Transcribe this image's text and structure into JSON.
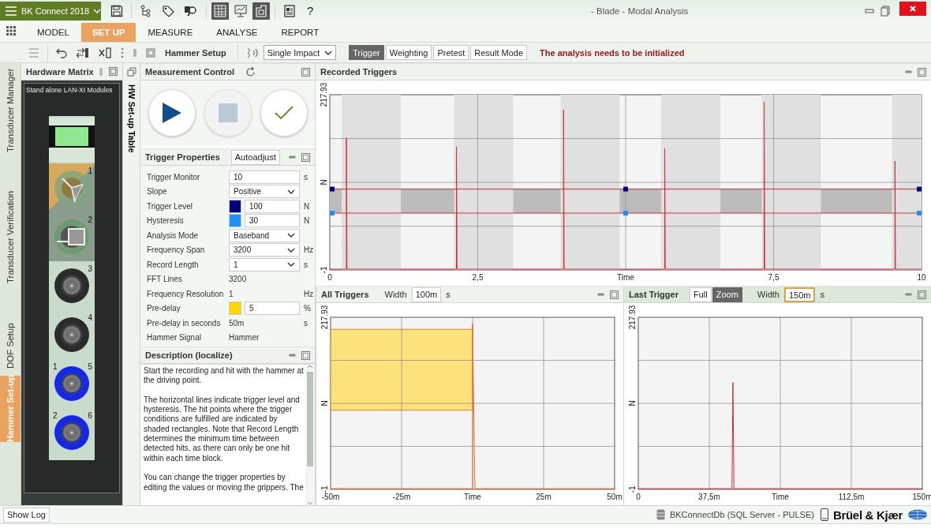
{
  "app_menu": {
    "label": "BK Connect 2018"
  },
  "window": {
    "title": "- Blade - Modal Analysis",
    "help": "?"
  },
  "view_toggles": [
    {
      "on": true
    },
    {
      "on": false
    },
    {
      "on": true
    }
  ],
  "ribbon_tabs": [
    {
      "label": "MODEL",
      "selected": false
    },
    {
      "label": "SET UP",
      "selected": true
    },
    {
      "label": "MEASURE",
      "selected": false
    },
    {
      "label": "ANALYSE",
      "selected": false
    },
    {
      "label": "REPORT",
      "selected": false
    }
  ],
  "toolbar": {
    "title": "Hammer Setup",
    "mode": "Single Impact",
    "buttons": [
      {
        "label": "Trigger",
        "selected": true
      },
      {
        "label": "Weighting",
        "selected": false
      },
      {
        "label": "Pretest",
        "selected": false
      },
      {
        "label": "Result Mode",
        "selected": false
      }
    ],
    "message": "The analysis needs to be initialized"
  },
  "side_tabs": [
    {
      "label": "Transducer Manager",
      "selected": false
    },
    {
      "label": "Transducer Verification",
      "selected": false
    },
    {
      "label": "DOF Setup",
      "selected": false
    },
    {
      "label": "Hammer Set-up",
      "selected": true
    }
  ],
  "hardware_matrix": {
    "title": "Hardware Matrix",
    "module_label": "Stand alone LAN-XI Modules",
    "channels": [
      {
        "kind": "display"
      },
      {
        "kind": "triax",
        "label": "1",
        "selected": true
      },
      {
        "kind": "square",
        "label": "2",
        "selected": false
      },
      {
        "kind": "connector",
        "label": "3",
        "assigned": false
      },
      {
        "kind": "connector",
        "label": "4",
        "assigned": false
      },
      {
        "kind": "connector",
        "point": "1",
        "label": "5",
        "assigned": true
      },
      {
        "kind": "connector",
        "point": "2",
        "label": "6",
        "assigned": true
      }
    ]
  },
  "hw_setup_table": {
    "label": "HW Set-up Table"
  },
  "measurement_control": {
    "title": "Measurement Control",
    "buttons": [
      {
        "kind": "play",
        "disabled": false
      },
      {
        "kind": "stop",
        "disabled": true
      },
      {
        "kind": "check",
        "disabled": false
      }
    ]
  },
  "trigger_properties": {
    "title": "Trigger Properties",
    "autoadjust": "Autoadjust",
    "rows": [
      {
        "kind": "input",
        "label": "Trigger Monitor",
        "value": "10",
        "unit": "s"
      },
      {
        "kind": "select",
        "label": "Slope",
        "value": "Positive"
      },
      {
        "kind": "color",
        "label": "Trigger Level",
        "color": "#000080",
        "value": "100",
        "unit": "N"
      },
      {
        "kind": "color",
        "label": "Hysteresis",
        "color": "#1e90ff",
        "value": "30",
        "unit": "N"
      },
      {
        "kind": "select",
        "label": "Analysis Mode",
        "value": "Baseband"
      },
      {
        "kind": "select",
        "label": "Frequency Span",
        "value": "3200",
        "unit": "Hz"
      },
      {
        "kind": "select",
        "label": "Record Length",
        "value": "1",
        "unit": "s"
      },
      {
        "kind": "text",
        "label": "FFT Lines",
        "value": "3200"
      },
      {
        "kind": "text",
        "label": "Frequency Resolution",
        "value": "1",
        "unit": "Hz"
      },
      {
        "kind": "color",
        "label": "Pre-delay",
        "color": "#ffd700",
        "value": "5",
        "unit": "%"
      },
      {
        "kind": "text",
        "label": "Pre-delay in seconds",
        "value": "50m",
        "unit": "s"
      },
      {
        "kind": "text",
        "label": "Hammer Signal",
        "value": "Hammer"
      }
    ]
  },
  "description": {
    "title": "Description (localize)",
    "paragraphs": [
      "Start the recording and hit with the hammer at the driving point.",
      "The horizontal lines indicate trigger level and hysteresis. The hit points where the trigger conditions are fulfilled are indicated by shaded rectangles. Note that Record Length determines the minimum time between detected hits, as there can only be one hit within each time block.",
      "You can change the trigger properties by editing the values or moving the grippers. The"
    ]
  },
  "recorded_triggers": {
    "title": "Recorded Triggers",
    "chart_data": {
      "type": "line",
      "xlabel": "Time",
      "ylabel": "N",
      "xlim": [
        0,
        10
      ],
      "ylim": [
        -1,
        217.93
      ],
      "xticks": [
        {
          "value": 0,
          "label": "0"
        },
        {
          "value": 2.5,
          "label": "2,5"
        },
        {
          "value": 7.5,
          "label": "7,5"
        },
        {
          "value": 10,
          "label": "10"
        }
      ],
      "yticks": [
        {
          "value": -1,
          "label": "-1"
        },
        {
          "value": 217.93,
          "label": "217.93"
        }
      ],
      "x": [
        0,
        0.28,
        0.28,
        0.29,
        2.14,
        2.14,
        2.15,
        3.95,
        3.95,
        3.96,
        5.66,
        5.66,
        5.67,
        7.34,
        7.34,
        7.35,
        9.55,
        9.55,
        9.56,
        10
      ],
      "series": [
        {
          "color": "#d03030",
          "values": [
            0,
            0,
            164,
            0,
            0,
            153,
            0,
            0,
            199,
            0,
            0,
            151,
            0,
            0,
            209,
            0,
            0,
            135,
            0,
            0
          ]
        }
      ],
      "bands": [
        {
          "axis": "y",
          "from": 70,
          "to": 100,
          "color": "#bcbcbc"
        },
        {
          "axis": "x",
          "from": 0.2,
          "to": 1.2,
          "color": "#e0e0e0"
        },
        {
          "axis": "x",
          "from": 2.1,
          "to": 3.1,
          "color": "#e0e0e0"
        },
        {
          "axis": "x",
          "from": 3.9,
          "to": 4.9,
          "color": "#e0e0e0"
        },
        {
          "axis": "x",
          "from": 5.6,
          "to": 6.6,
          "color": "#e0e0e0"
        },
        {
          "axis": "x",
          "from": 7.3,
          "to": 8.3,
          "color": "#e0e0e0"
        },
        {
          "axis": "x",
          "from": 9.5,
          "to": 10,
          "color": "#e0e0e0"
        }
      ],
      "ref_lines": [
        {
          "axis": "y",
          "value": 100,
          "color": "#c83030"
        },
        {
          "axis": "y",
          "value": 70,
          "color": "#c83030"
        }
      ]
    }
  },
  "all_triggers": {
    "title": "All Triggers",
    "width_label": "Width",
    "width_value": "100m",
    "width_focused": false,
    "width_unit": "s",
    "pre_delay_area": true,
    "chart_data": {
      "type": "line",
      "xlabel": "Time",
      "ylabel": "N",
      "xlim": [
        -50,
        50
      ],
      "ylim": [
        -1,
        217.93
      ],
      "xticks": [
        {
          "value": -50,
          "label": "-50m"
        },
        {
          "value": -25,
          "label": "-25m"
        },
        {
          "value": 25,
          "label": "25m"
        },
        {
          "value": 50,
          "label": "50m"
        }
      ],
      "yticks": [
        {
          "value": -1,
          "label": "-1"
        },
        {
          "value": 217.93,
          "label": "217.93"
        }
      ],
      "x": [
        -50,
        0,
        0,
        0.8,
        50
      ],
      "series": [
        {
          "color": "#e07030",
          "values": [
            0,
            0,
            210,
            0,
            0
          ]
        }
      ]
    }
  },
  "last_trigger": {
    "title": "Last Trigger",
    "modes": [
      {
        "label": "Full",
        "selected": false
      },
      {
        "label": "Zoom",
        "selected": true
      }
    ],
    "width_label": "Width",
    "width_value": "150m",
    "width_focused": true,
    "width_unit": "s",
    "chart_data": {
      "type": "line",
      "xlabel": "Time",
      "ylabel": "N",
      "xlim": [
        0,
        150
      ],
      "ylim": [
        -1,
        217.93
      ],
      "xticks": [
        {
          "value": 0,
          "label": "0"
        },
        {
          "value": 37.5,
          "label": "37,5m"
        },
        {
          "value": 112.5,
          "label": "112,5m"
        },
        {
          "value": 150,
          "label": "150m"
        }
      ],
      "yticks": [
        {
          "value": -1,
          "label": "-1"
        },
        {
          "value": 217.93,
          "label": "217.93"
        }
      ],
      "x": [
        0,
        49.5,
        50,
        50.5,
        51,
        150
      ],
      "series": [
        {
          "color": "#d03030",
          "values": [
            0,
            0,
            135,
            -1,
            0,
            0
          ]
        }
      ]
    }
  },
  "status_bar": {
    "show_log": "Show Log",
    "database": "BKConnectDb (SQL Server - PULSE)",
    "brand": "Brüel & Kjær"
  }
}
